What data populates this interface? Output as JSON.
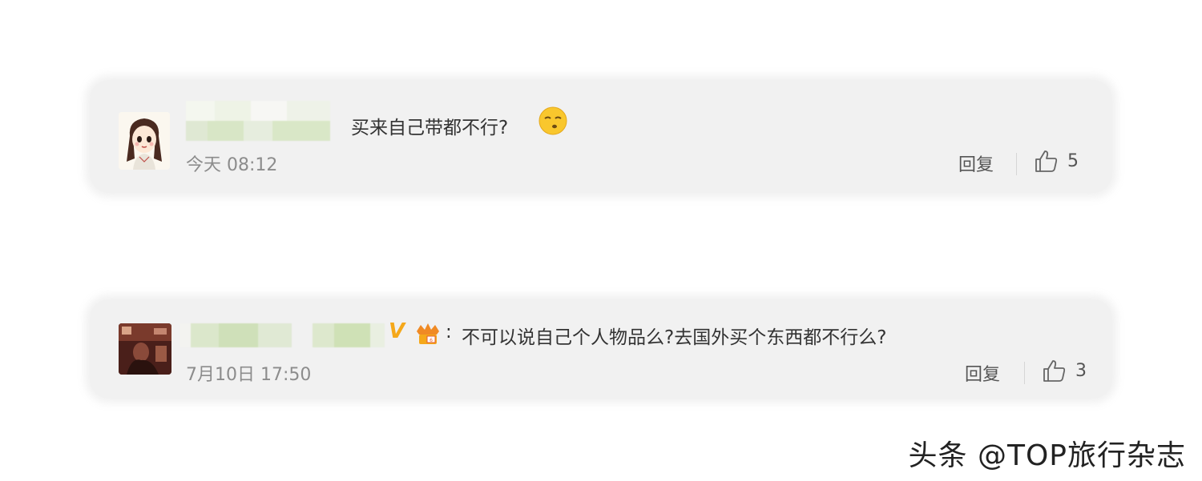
{
  "comments": [
    {
      "text": "买来自己带都不行?",
      "time": "今天 08:12",
      "reply_label": "回复",
      "like_count": "5",
      "emoji": "smirk-emoji-icon",
      "avatar": "cartoon-girl-avatar"
    },
    {
      "verified_mark": "V",
      "colon": ":",
      "text": "不可以说自己个人物品么?去国外买个东西都不行么?",
      "time": "7月10日 17:50",
      "reply_label": "回复",
      "like_count": "3",
      "avatar": "photo-avatar"
    }
  ],
  "watermark": "头条 @TOP旅行杂志",
  "colors": {
    "card_bg": "#f1f1f1",
    "text": "#333333",
    "muted": "#8c8c8c",
    "verified": "#f5a81a"
  }
}
